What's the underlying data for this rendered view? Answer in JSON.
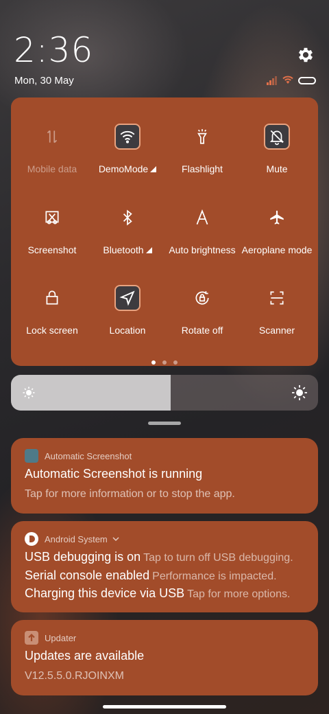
{
  "status": {
    "time": "2:36",
    "date": "Mon, 30 May",
    "icons": [
      "signal-icon",
      "wifi-icon",
      "battery-icon",
      "gear-icon"
    ]
  },
  "quick_settings": {
    "tiles": [
      {
        "label": "Mobile data",
        "icon": "mobile-data-icon",
        "active": false,
        "disabled": true
      },
      {
        "label": "DemoMode",
        "icon": "wifi-icon",
        "active": true,
        "expandable": true
      },
      {
        "label": "Flashlight",
        "icon": "flashlight-icon",
        "active": false
      },
      {
        "label": "Mute",
        "icon": "bell-off-icon",
        "active": true
      },
      {
        "label": "Screenshot",
        "icon": "screenshot-icon",
        "active": false
      },
      {
        "label": "Bluetooth",
        "icon": "bluetooth-icon",
        "active": false,
        "expandable": true
      },
      {
        "label": "Auto brightness",
        "icon": "auto-brightness-icon",
        "active": false
      },
      {
        "label": "Aeroplane mode",
        "icon": "airplane-icon",
        "active": false
      },
      {
        "label": "Lock screen",
        "icon": "lock-icon",
        "active": false
      },
      {
        "label": "Location",
        "icon": "location-icon",
        "active": true
      },
      {
        "label": "Rotate off",
        "icon": "rotate-lock-icon",
        "active": false
      },
      {
        "label": "Scanner",
        "icon": "scanner-icon",
        "active": false
      }
    ],
    "page_count": 3,
    "current_page": 1,
    "accent": "#a24c2a"
  },
  "brightness": {
    "level": 0.52
  },
  "notifications": [
    {
      "app": "Automatic Screenshot",
      "title": "Automatic Screenshot is running",
      "text": "Tap for more information or to stop the app."
    },
    {
      "app": "Android System",
      "lines": [
        {
          "title": "USB debugging is on",
          "text": "Tap to turn off USB debugging."
        },
        {
          "title": "Serial console enabled",
          "text": "Performance is impacted."
        },
        {
          "title": "Charging this device via USB",
          "text": "Tap for more options."
        }
      ]
    },
    {
      "app": "Updater",
      "title": "Updates are available",
      "text": "V12.5.5.0.RJOINXM"
    }
  ]
}
